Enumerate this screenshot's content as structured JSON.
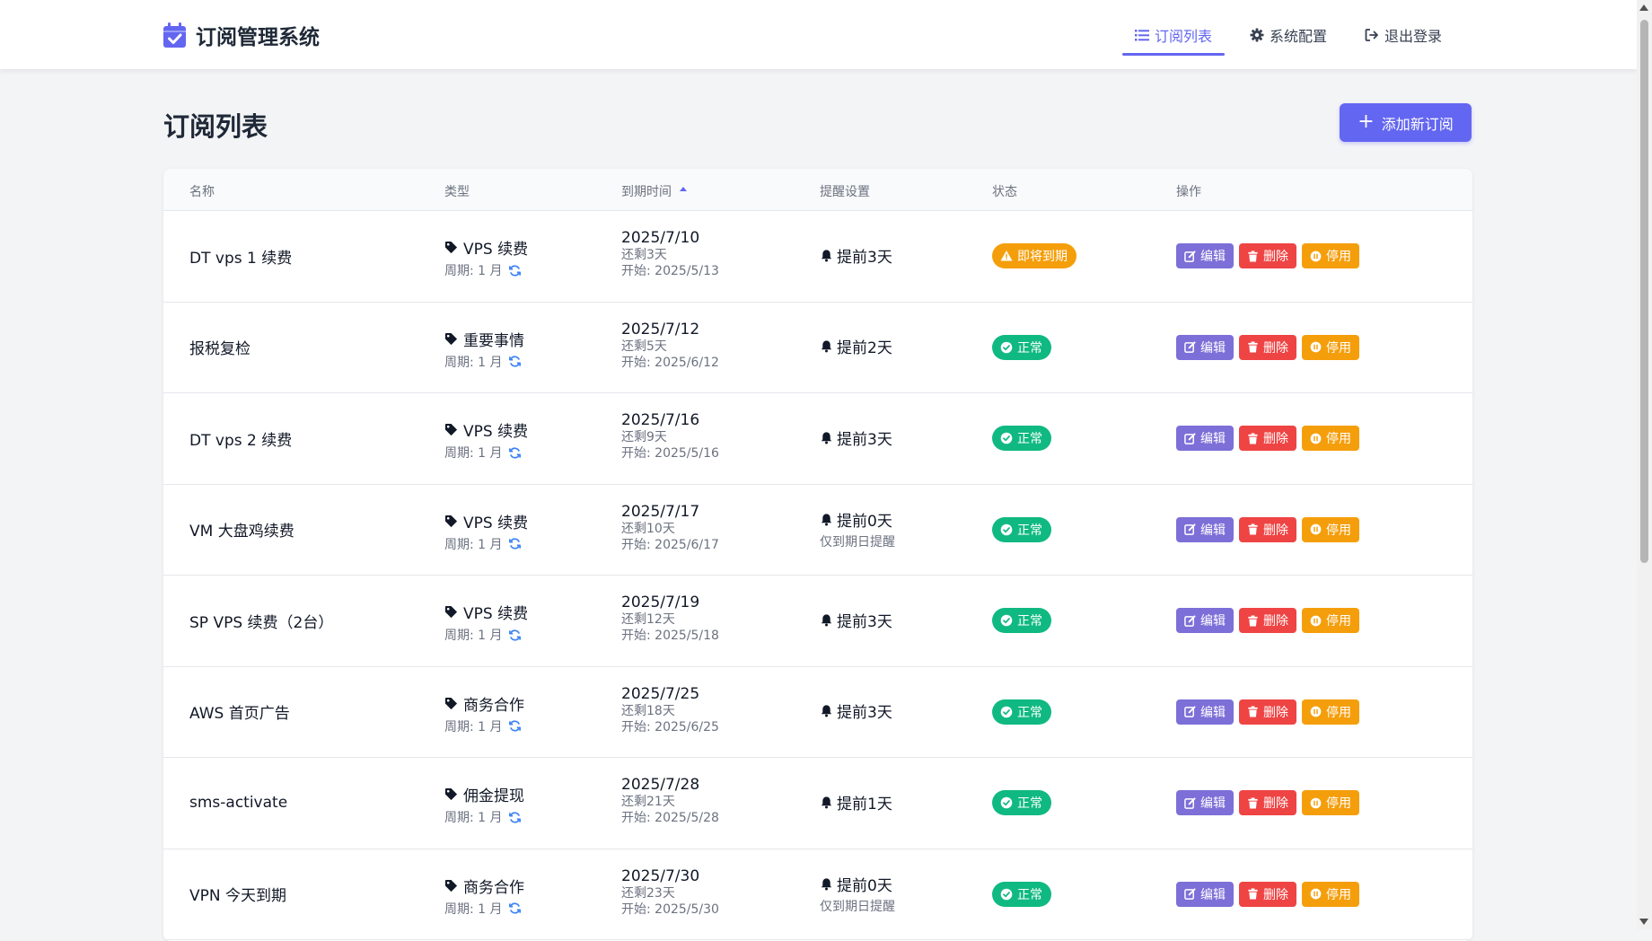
{
  "app": {
    "title": "订阅管理系统",
    "accent_color": "#6366f1"
  },
  "nav": {
    "items": [
      {
        "label": "订阅列表",
        "icon": "list-icon",
        "active": true
      },
      {
        "label": "系统配置",
        "icon": "gear-icon",
        "active": false
      },
      {
        "label": "退出登录",
        "icon": "logout-icon",
        "active": false
      }
    ]
  },
  "page": {
    "title": "订阅列表",
    "add_button_label": "添加新订阅"
  },
  "table": {
    "headers": {
      "name": "名称",
      "type": "类型",
      "expiry": "到期时间",
      "reminder": "提醒设置",
      "status": "状态",
      "actions": "操作"
    },
    "sort": {
      "column": "expiry",
      "direction": "asc"
    },
    "action_labels": {
      "edit": "编辑",
      "delete": "删除",
      "disable": "停用"
    },
    "rows": [
      {
        "name": "DT vps 1 续费",
        "type": "VPS 续费",
        "period": "周期: 1 月",
        "expiry": "2025/7/10",
        "left": "还剩3天",
        "start": "开始: 2025/5/13",
        "reminder": "提前3天",
        "reminder_note": "",
        "status": "即将到期",
        "status_kind": "warn"
      },
      {
        "name": "报税复检",
        "type": "重要事情",
        "period": "周期: 1 月",
        "expiry": "2025/7/12",
        "left": "还剩5天",
        "start": "开始: 2025/6/12",
        "reminder": "提前2天",
        "reminder_note": "",
        "status": "正常",
        "status_kind": "ok"
      },
      {
        "name": "DT vps 2 续费",
        "type": "VPS 续费",
        "period": "周期: 1 月",
        "expiry": "2025/7/16",
        "left": "还剩9天",
        "start": "开始: 2025/5/16",
        "reminder": "提前3天",
        "reminder_note": "",
        "status": "正常",
        "status_kind": "ok"
      },
      {
        "name": "VM 大盘鸡续费",
        "type": "VPS 续费",
        "period": "周期: 1 月",
        "expiry": "2025/7/17",
        "left": "还剩10天",
        "start": "开始: 2025/6/17",
        "reminder": "提前0天",
        "reminder_note": "仅到期日提醒",
        "status": "正常",
        "status_kind": "ok"
      },
      {
        "name": "SP VPS 续费（2台）",
        "type": "VPS 续费",
        "period": "周期: 1 月",
        "expiry": "2025/7/19",
        "left": "还剩12天",
        "start": "开始: 2025/5/18",
        "reminder": "提前3天",
        "reminder_note": "",
        "status": "正常",
        "status_kind": "ok"
      },
      {
        "name": "AWS 首页广告",
        "type": "商务合作",
        "period": "周期: 1 月",
        "expiry": "2025/7/25",
        "left": "还剩18天",
        "start": "开始: 2025/6/25",
        "reminder": "提前3天",
        "reminder_note": "",
        "status": "正常",
        "status_kind": "ok"
      },
      {
        "name": "sms-activate",
        "type": "佣金提现",
        "period": "周期: 1 月",
        "expiry": "2025/7/28",
        "left": "还剩21天",
        "start": "开始: 2025/5/28",
        "reminder": "提前1天",
        "reminder_note": "",
        "status": "正常",
        "status_kind": "ok"
      },
      {
        "name": "VPN 今天到期",
        "type": "商务合作",
        "period": "周期: 1 月",
        "expiry": "2025/7/30",
        "left": "还剩23天",
        "start": "开始: 2025/5/30",
        "reminder": "提前0天",
        "reminder_note": "仅到期日提醒",
        "status": "正常",
        "status_kind": "ok"
      }
    ]
  }
}
